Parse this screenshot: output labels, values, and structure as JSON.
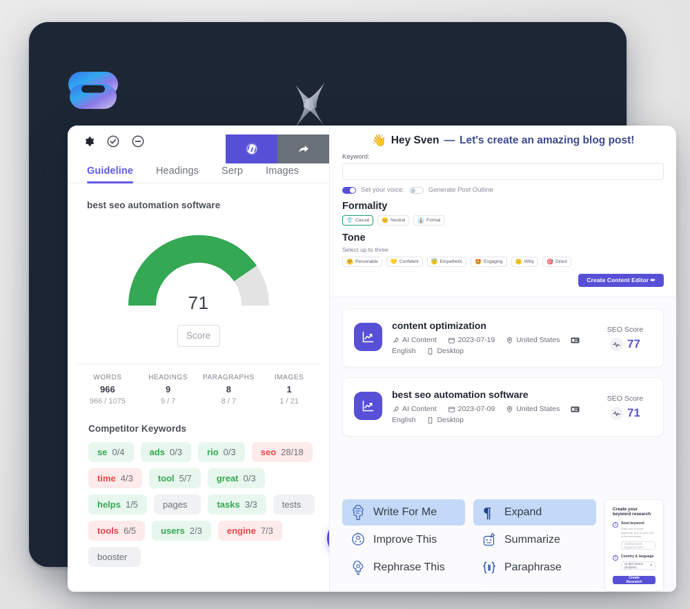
{
  "device": {
    "logo_icon": "brand-logo-gradient",
    "sparkle_icon": "sparkle-star-icon"
  },
  "left_panel": {
    "toolbar_icons": [
      "gear-icon",
      "check-circle-icon",
      "minus-circle-icon"
    ],
    "actions": [
      {
        "name": "wordpress-publish",
        "icon": "wordpress-icon",
        "color": "#5750d6"
      },
      {
        "name": "share",
        "icon": "share-arrow-icon",
        "color": "#6a7079"
      }
    ],
    "tabs": [
      {
        "label": "Guideline",
        "active": true
      },
      {
        "label": "Headings",
        "active": false
      },
      {
        "label": "Serp",
        "active": false
      },
      {
        "label": "Images",
        "active": false
      }
    ],
    "keyword_title": "best seo automation software",
    "gauge": {
      "value": "71",
      "value_num": 71,
      "max": 100,
      "fill_color": "#34a853",
      "track_color": "#e3e3e3"
    },
    "score_button": "Score",
    "stats": [
      {
        "label": "WORDS",
        "value": "966",
        "sub": "966 / 1075"
      },
      {
        "label": "HEADINGS",
        "value": "9",
        "sub": "9 / 7"
      },
      {
        "label": "PARAGRAPHS",
        "value": "8",
        "sub": "8 / 7"
      },
      {
        "label": "IMAGES",
        "value": "1",
        "sub": "1 / 21"
      }
    ],
    "competitor_title": "Competitor Keywords",
    "keywords": [
      {
        "word": "se",
        "count": "0/4",
        "state": "green"
      },
      {
        "word": "ads",
        "count": "0/3",
        "state": "green"
      },
      {
        "word": "rio",
        "count": "0/3",
        "state": "green"
      },
      {
        "word": "seo",
        "count": "28/18",
        "state": "red"
      },
      {
        "word": "time",
        "count": "4/3",
        "state": "red"
      },
      {
        "word": "tool",
        "count": "5/7",
        "state": "green"
      },
      {
        "word": "great",
        "count": "0/3",
        "state": "green"
      },
      {
        "word": "helps",
        "count": "1/5",
        "state": "green"
      },
      {
        "word": "pages",
        "count": "",
        "state": "grey"
      },
      {
        "word": "tasks",
        "count": "3/3",
        "state": "green"
      },
      {
        "word": "tests",
        "count": "",
        "state": "grey"
      },
      {
        "word": "tools",
        "count": "6/5",
        "state": "red"
      },
      {
        "word": "users",
        "count": "2/3",
        "state": "green"
      },
      {
        "word": "engine",
        "count": "7/3",
        "state": "red"
      },
      {
        "word": "booster",
        "count": "",
        "state": "grey"
      }
    ],
    "help_button_icon": "question-mark-icon"
  },
  "right_panel": {
    "hero": {
      "emoji": "waving-hand-icon",
      "greeting": "Hey Sven",
      "dash": "—",
      "tagline": "Let's create an amazing blog post!"
    },
    "keyword_field": {
      "label": "Keyword:",
      "value": "",
      "placeholder": ""
    },
    "toggles": [
      {
        "label": "Set your voice:",
        "on": true
      },
      {
        "label": "Generate Post Outline",
        "on": false
      }
    ],
    "formality": {
      "heading": "Formality",
      "options": [
        {
          "label": "Casual",
          "emoji": "👕",
          "selected": true
        },
        {
          "label": "Neutral",
          "emoji": "😐",
          "selected": false
        },
        {
          "label": "Formal",
          "emoji": "👔",
          "selected": false
        }
      ]
    },
    "tone": {
      "heading": "Tone",
      "subtitle": "Select up to three",
      "options": [
        {
          "label": "Personable",
          "emoji": "🤗"
        },
        {
          "label": "Confident",
          "emoji": "💛"
        },
        {
          "label": "Empathetic",
          "emoji": "😇"
        },
        {
          "label": "Engaging",
          "emoji": "🤩"
        },
        {
          "label": "Witty",
          "emoji": "🙃"
        },
        {
          "label": "Direct",
          "emoji": "🎯"
        }
      ]
    },
    "create_button": "Create Content Editor ✏",
    "cards": [
      {
        "icon": "chart-line-icon",
        "title": "content optimization",
        "type_icon": "rocket-icon",
        "type": "AI Content",
        "date_icon": "calendar-icon",
        "date": "2023-07-19",
        "location_icon": "pin-icon",
        "location": "United States",
        "lang_icon": "keyboard-icon",
        "language": "English",
        "device_icon": "monitor-icon",
        "device": "Desktop",
        "score_label": "SEO Score",
        "score_icon": "pulse-icon",
        "score": "77"
      },
      {
        "icon": "chart-line-icon",
        "title": "best seo automation software",
        "type_icon": "rocket-icon",
        "type": "AI Content",
        "date_icon": "calendar-icon",
        "date": "2023-07-09",
        "location_icon": "pin-icon",
        "location": "United States",
        "lang_icon": "keyboard-icon",
        "language": "English",
        "device_icon": "monitor-icon",
        "device": "Desktop",
        "score_label": "SEO Score",
        "score_icon": "pulse-icon",
        "score": "71"
      }
    ],
    "tools": {
      "col1": [
        {
          "label": "Write For Me",
          "icon": "ai-writer-icon",
          "highlighted": true
        },
        {
          "label": "Improve This",
          "icon": "robot-head-icon",
          "highlighted": false
        },
        {
          "label": "Rephrase This",
          "icon": "brain-gear-icon",
          "highlighted": false
        }
      ],
      "col2": [
        {
          "label": "Expand",
          "icon": "pilcrow-icon",
          "highlighted": true
        },
        {
          "label": "Summarize",
          "icon": "robot-note-icon",
          "highlighted": false
        },
        {
          "label": "Paraphrase",
          "icon": "brackets-icon",
          "highlighted": false
        }
      ]
    },
    "keyword_research": {
      "title": "Create your keyword research",
      "step1_num": "1",
      "step1_label": "Seed keyword",
      "step1_hint": "Enter one or more keywords, one in each line in the box below",
      "step1_placeholder": "Adding seed keyword here",
      "step2_num": "2",
      "step2_label": "Country & language",
      "step2_value": "United States (English)",
      "button": "Create Research"
    }
  },
  "colors": {
    "accent": "#5750d6",
    "tab_active": "#6058e8",
    "green": "#34a853",
    "red": "#e8474b",
    "device_bg": "#1b2433"
  }
}
